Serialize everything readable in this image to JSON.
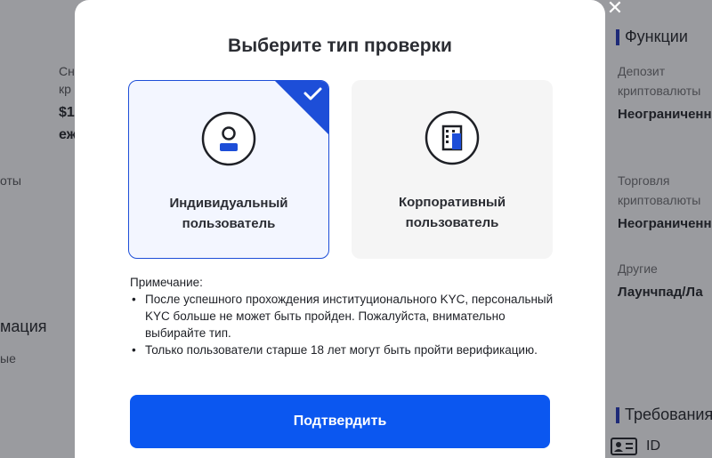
{
  "background": {
    "left_fragments": [
      "Сн",
      "кр",
      "$1",
      "еж",
      "оты",
      "мация",
      "ые"
    ],
    "right": {
      "section1_title": "Функции",
      "items": [
        {
          "label_line1": "Депозит",
          "label_line2": "криптовалюты",
          "value": "Неограниченно"
        },
        {
          "label_line1": "Торговля",
          "label_line2": "криптовалюты",
          "value": "Неограниченно"
        },
        {
          "label_line1": "Другие",
          "label_line2": "",
          "value": "Лаунчпад/Ла"
        }
      ],
      "section2_title": "Требования",
      "id_label": "ID"
    }
  },
  "modal": {
    "title": "Выберите тип проверки",
    "options": [
      {
        "label_line1": "Индивидуальный",
        "label_line2": "пользователь",
        "icon": "user-icon",
        "selected": true
      },
      {
        "label_line1": "Корпоративный",
        "label_line2": "пользователь",
        "icon": "building-icon",
        "selected": false
      }
    ],
    "note": {
      "heading": "Примечание:",
      "items": [
        "После успешного прохождения институционального KYC, персональный KYC больше не может быть пройден. Пожалуйста, внимательно выбирайте тип.",
        "Только пользователи старше 18 лет могут быть пройти верификацию."
      ]
    },
    "confirm_label": "Подтвердить"
  },
  "colors": {
    "accent": "#0b57f0",
    "selected_border": "#1d4ed8",
    "overlay": "#9a9b9f"
  }
}
